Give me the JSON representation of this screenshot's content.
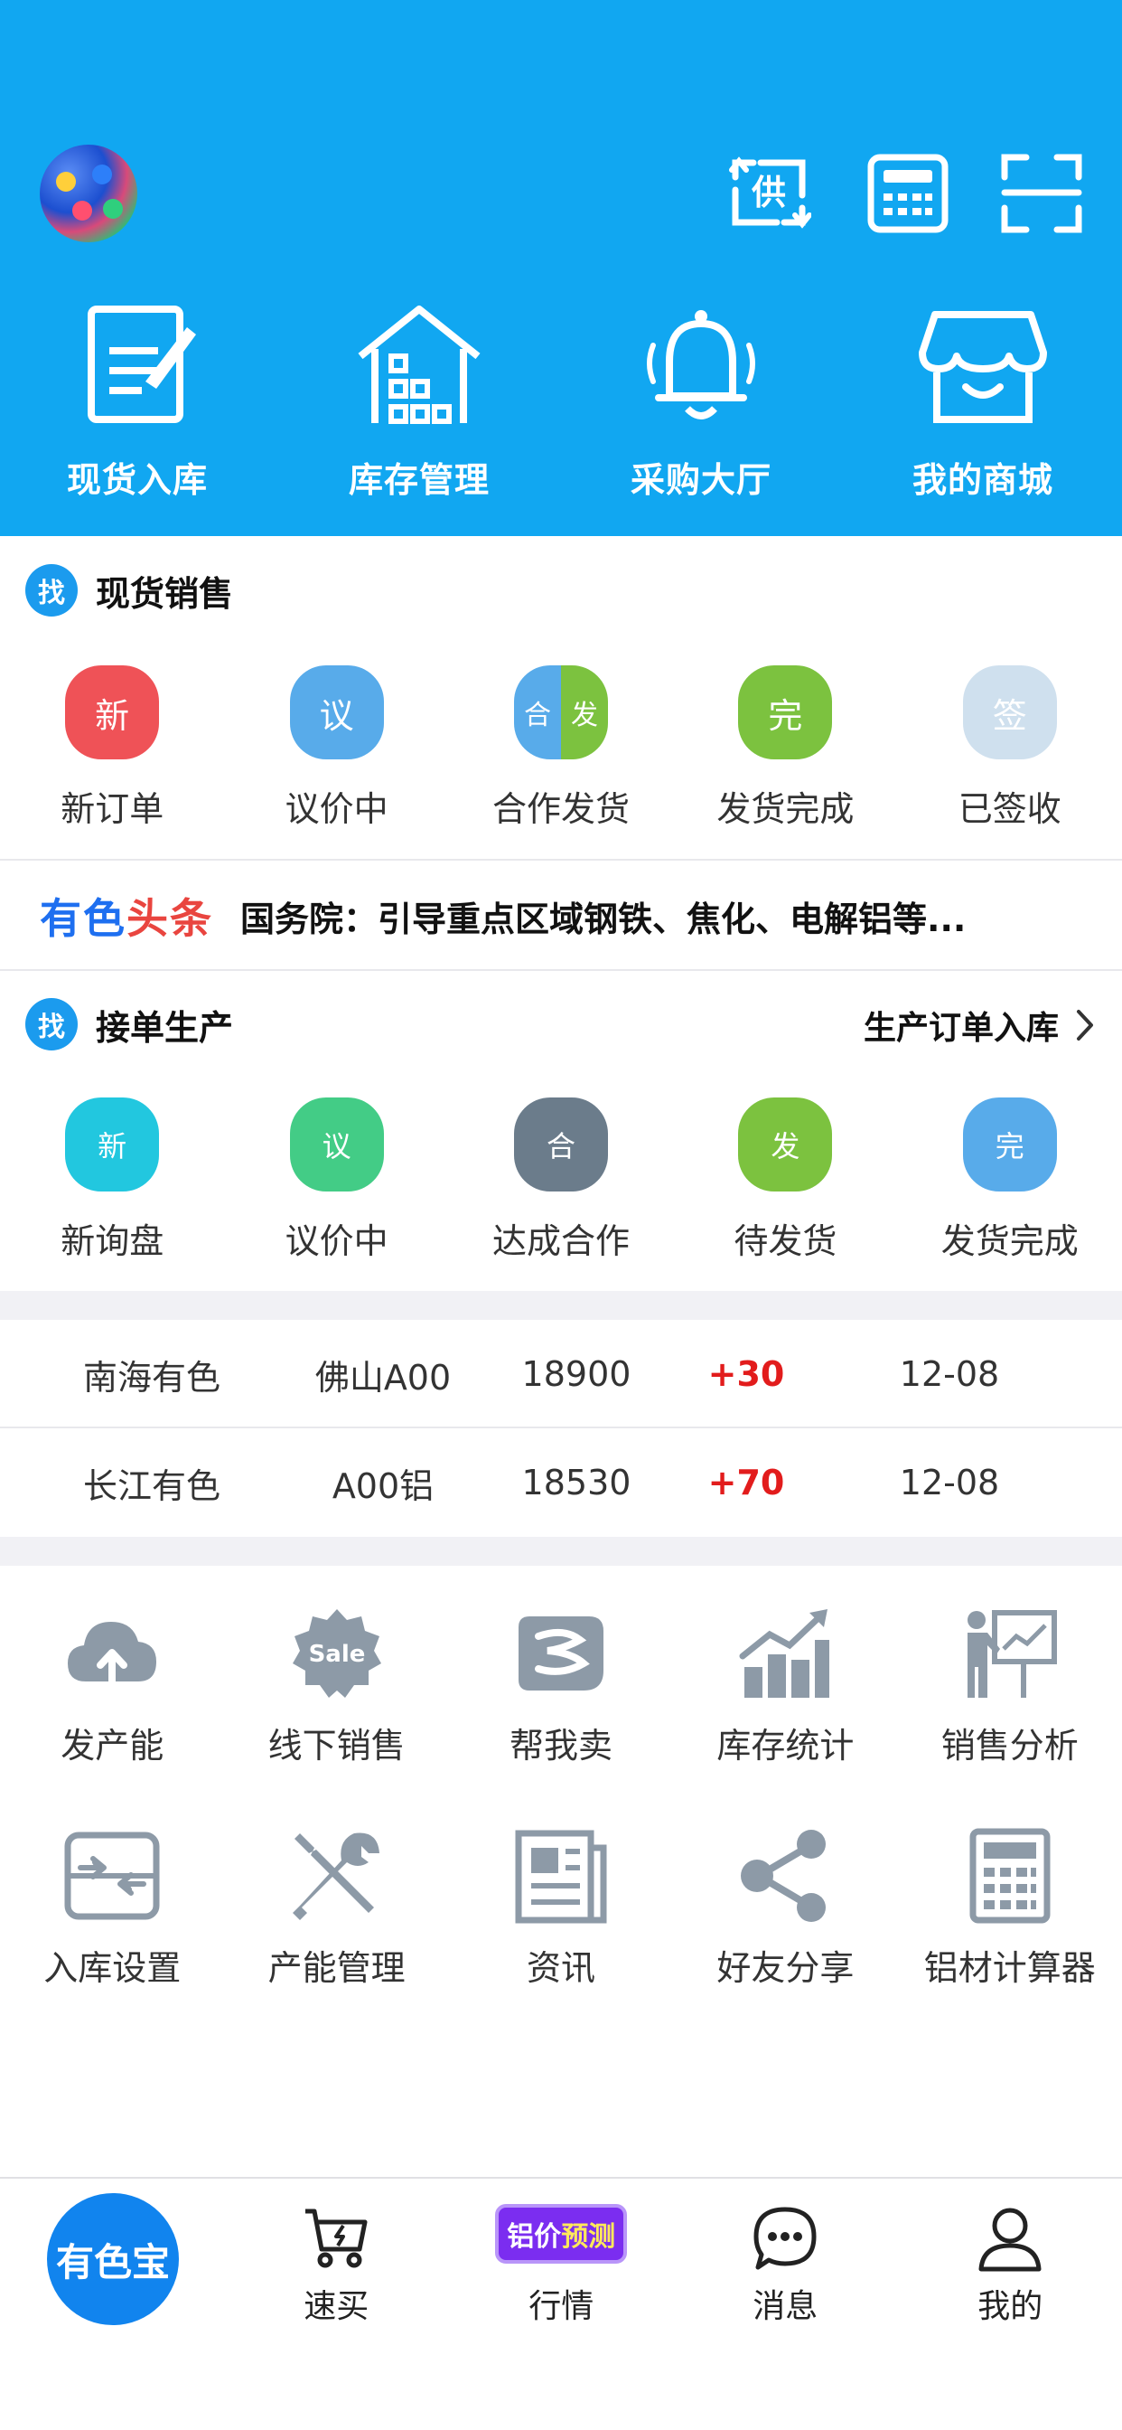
{
  "header": {
    "icons": [
      "avatar",
      "supply-exchange-icon",
      "calculator-icon",
      "scan-icon"
    ],
    "supply_label": "供",
    "background": "#11a7f1"
  },
  "quick_actions": [
    {
      "label": "现货入库",
      "icon": "document-edit-icon"
    },
    {
      "label": "库存管理",
      "icon": "warehouse-icon"
    },
    {
      "label": "采购大厅",
      "icon": "bell-icon"
    },
    {
      "label": "我的商城",
      "icon": "store-icon"
    }
  ],
  "spot_sales": {
    "badge": "找",
    "title": "现货销售",
    "statuses": [
      {
        "glyph": "新",
        "label": "新订单",
        "color": "#ef5257"
      },
      {
        "glyph": "议",
        "label": "议价中",
        "color": "#58abea"
      },
      {
        "glyph_left": "合",
        "glyph_right": "发",
        "label": "合作发货",
        "color_left": "#58abea",
        "color_right": "#7cc23f"
      },
      {
        "glyph": "完",
        "label": "发货完成",
        "color": "#7cc23f"
      },
      {
        "glyph": "签",
        "label": "已签收",
        "color": "#cfe0ee"
      }
    ]
  },
  "news": {
    "brand_blue": "有色",
    "brand_red": "头条",
    "headline": "国务院：引导重点区域钢铁、焦化、电解铝等..."
  },
  "production": {
    "badge": "找",
    "title": "接单生产",
    "link": "生产订单入库",
    "statuses": [
      {
        "glyph": "新",
        "label": "新询盘",
        "color": "#22c7df"
      },
      {
        "glyph": "议",
        "label": "议价中",
        "color": "#43cc86"
      },
      {
        "glyph": "合",
        "label": "达成合作",
        "color": "#6b7c8b"
      },
      {
        "glyph": "发",
        "label": "待发货",
        "color": "#7cc23f"
      },
      {
        "glyph": "完",
        "label": "发货完成",
        "color": "#58abea"
      }
    ]
  },
  "prices": [
    {
      "market": "南海有色",
      "product": "佛山A00",
      "price": "18900",
      "change": "+30",
      "date": "12-08"
    },
    {
      "market": "长江有色",
      "product": "A00铝",
      "price": "18530",
      "change": "+70",
      "date": "12-08"
    }
  ],
  "tools_row1": [
    {
      "label": "发产能",
      "icon": "cloud-upload-icon"
    },
    {
      "label": "线下销售",
      "icon": "sale-badge-icon",
      "icon_text": "Sale"
    },
    {
      "label": "帮我卖",
      "icon": "help-sell-icon"
    },
    {
      "label": "库存统计",
      "icon": "bar-chart-icon"
    },
    {
      "label": "销售分析",
      "icon": "presentation-icon"
    }
  ],
  "tools_row2": [
    {
      "label": "入库设置",
      "icon": "inbound-settings-icon"
    },
    {
      "label": "产能管理",
      "icon": "tools-icon"
    },
    {
      "label": "资讯",
      "icon": "newspaper-icon"
    },
    {
      "label": "好友分享",
      "icon": "share-icon"
    },
    {
      "label": "铝材计算器",
      "icon": "calculator-icon"
    }
  ],
  "tabbar": {
    "home": "有色宝",
    "buy": "速买",
    "market_badge_a": "铝价",
    "market_badge_b": "预测",
    "market": "行情",
    "messages": "消息",
    "me": "我的"
  }
}
